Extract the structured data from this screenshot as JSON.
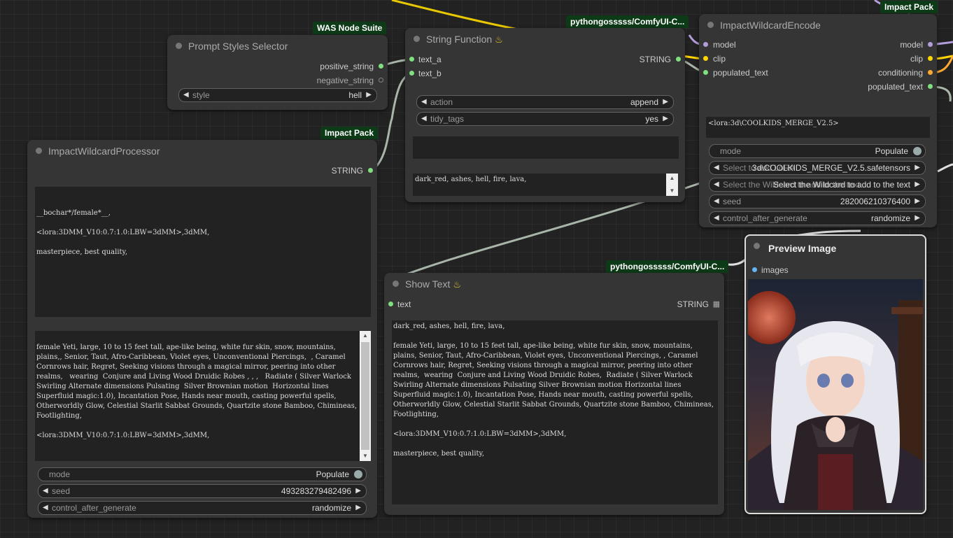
{
  "prompt_styles": {
    "badge": "WAS Node Suite",
    "title": "Prompt Styles Selector",
    "out_positive": "positive_string",
    "out_negative": "negative_string",
    "style_label": "style",
    "style_value": "hell"
  },
  "string_function": {
    "badge": "pythongosssss/ComfyUI-C...",
    "title": "String Function",
    "in_a": "text_a",
    "in_b": "text_b",
    "out": "STRING",
    "action_label": "action",
    "action_value": "append",
    "tidy_label": "tidy_tags",
    "tidy_value": "yes",
    "text_result": "dark_red, ashes, hell, fire, lava,"
  },
  "wildcard_encode": {
    "badge": "Impact Pack",
    "title": "ImpactWildcardEncode",
    "in_model": "model",
    "in_clip": "clip",
    "in_populated": "populated_text",
    "out_model": "model",
    "out_clip": "clip",
    "out_conditioning": "conditioning",
    "out_populated": "populated_text",
    "text": "<lora:3d\\COOLKIDS_MERGE_V2.5>",
    "mode_label": "mode",
    "mode_value": "Populate",
    "lora_label": "Select to add LoRA",
    "lora_value": "3d\\COOLKIDS_MERGE_V2.5.safetensors",
    "wildcard_label": "Select the Wildcard to add to the text",
    "wildcard_value": "Select the Wildcard to add to the text",
    "seed_label": "seed",
    "seed_value": "282006210376400",
    "control_label": "control_after_generate",
    "control_value": "randomize"
  },
  "wildcard_processor": {
    "badge": "Impact Pack",
    "title": "ImpactWildcardProcessor",
    "out": "STRING",
    "wildcard_text": "\n\n__bochar*/female*__,\n\n<lora:3DMM_V10:0.7:1.0:LBW=3dMM>,3dMM,\n\nmasterpiece, best quality,",
    "populated_text": "\nfemale Yeti, large, 10 to 15 feet tall, ape-like being, white fur skin, snow, mountains, plains,, Senior, Taut, Afro-Caribbean, Violet eyes, Unconventional Piercings,  , Caramel Cornrows hair, Regret, Seeking visions through a magical mirror, peering into other realms,   wearing  Conjure and Living Wood Druidic Robes , , ,   Radiate ( Silver Warlock  Swirling Alternate dimensions Pulsating  Silver Brownian motion  Horizontal lines Superfluid magic:1.0), Incantation Pose, Hands near mouth, casting powerful spells, Otherworldly Glow, Celestial Starlit Sabbat Grounds, Quartzite stone Bamboo, Chimineas, Footlighting,\n\n<lora:3DMM_V10:0.7:1.0:LBW=3dMM>,3dMM,",
    "mode_label": "mode",
    "mode_value": "Populate",
    "seed_label": "seed",
    "seed_value": "493283279482496",
    "control_label": "control_after_generate",
    "control_value": "randomize"
  },
  "show_text": {
    "badge": "pythongosssss/ComfyUI-C...",
    "title": "Show Text",
    "in": "text",
    "out": "STRING",
    "text": "dark_red, ashes, hell, fire, lava,\n\nfemale Yeti, large, 10 to 15 feet tall, ape-like being, white fur skin, snow, mountains, plains, Senior, Taut, Afro-Caribbean, Violet eyes, Unconventional Piercings, , Caramel Cornrows hair, Regret, Seeking visions through a magical mirror, peering into other realms,  wearing  Conjure and Living Wood Druidic Robes,  Radiate ( Silver Warlock  Swirling Alternate dimensions Pulsating Silver Brownian motion Horizontal lines Superfluid magic:1.0), Incantation Pose, Hands near mouth, casting powerful spells, Otherworldly Glow, Celestial Starlit Sabbat Grounds, Quartzite stone Bamboo, Chimineas, Footlighting,\n\n<lora:3DMM_V10:0.7:1.0:LBW=3dMM>,3dMM,\n\nmasterpiece, best quality,"
  },
  "preview": {
    "title": "Preview Image",
    "in": "images"
  },
  "colors": {
    "wire_string": "#a8b5a8",
    "wire_clip": "#ffd500",
    "wire_model": "#b39ddb",
    "wire_cond": "#ffa931",
    "wire_image": "#e0e0e0",
    "pin_string": "#7fe07f",
    "pin_image": "#64b5f6"
  }
}
